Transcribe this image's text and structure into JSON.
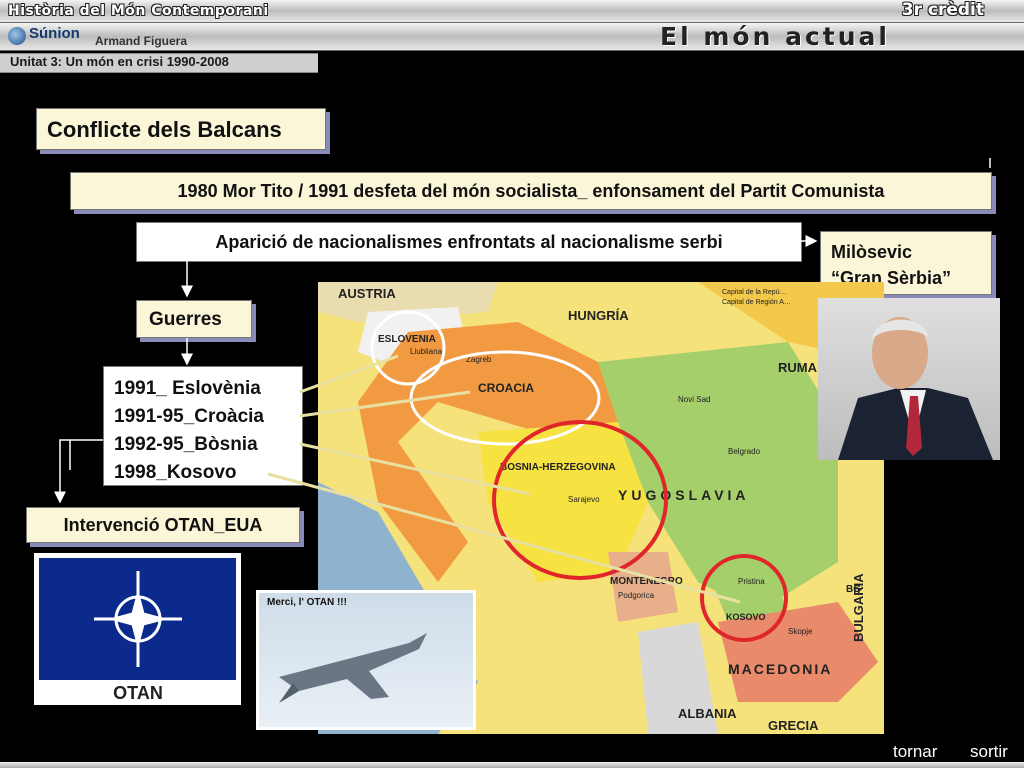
{
  "header": {
    "course": "Història del Món Contemporani",
    "credit": "3r crèdit",
    "logo": "Súnion",
    "author": "Armand Figuera",
    "title": "El món actual",
    "unit": "Unitat 3: Un món en crisi 1990-2008"
  },
  "slide": {
    "title": "Conflicte dels Balcans",
    "event": "1980 Mor Tito /  1991 desfeta del món socialista_ enfonsament del Partit Comunista",
    "nationalism": "Aparició de nacionalismes enfrontats al nacionalisme serbi",
    "milosevic": [
      "Milòsevic",
      "“Gran Sèrbia”"
    ],
    "wars_label": "Guerres",
    "wars": [
      "1991_ Eslovènia",
      "1991-95_Croàcia",
      "1992-95_Bòsnia",
      "1998_Kosovo"
    ],
    "intervention": "Intervenció OTAN_EUA"
  },
  "map_labels": {
    "austria": "AUSTRIA",
    "hungria": "HUNGRÍA",
    "eslovenia": "ESLOVENIA",
    "ljubljana": "Liubliana",
    "croacia": "CROACIA",
    "zagreb": "Zagreb",
    "bosnia": "BOSNIA-HERZEGOVINA",
    "sarajevo": "Sarajevo",
    "yugoslavia": "YUGOSLAVIA",
    "novi_sad": "Novi Sad",
    "belgrado": "Belgrado",
    "montenegro": "MONTENEGRO",
    "podgorica": "Podgorica",
    "kosovo": "KOSOVO",
    "pristina": "Pristina",
    "macedonia": "MACEDONIA",
    "skopje": "Skopje",
    "albania": "ALBANIA",
    "grecia": "GRECIA",
    "bulgaria": "BULGARIA",
    "rumania": "RUMA",
    "bg": "BG",
    "legend1": "Capital de la Repú…",
    "legend2": "Capital de Región A…"
  },
  "nato": {
    "label": "OTAN"
  },
  "f16": {
    "caption": "Merci, l' OTAN !!!"
  },
  "nav": {
    "back": "tornar",
    "exit": "sortir"
  },
  "colors": {
    "box_bg": "#fbf6d8",
    "box_shadow": "#8a8ab8",
    "nato_blue": "#0b2a8c",
    "circle_red": "#e0262a"
  }
}
